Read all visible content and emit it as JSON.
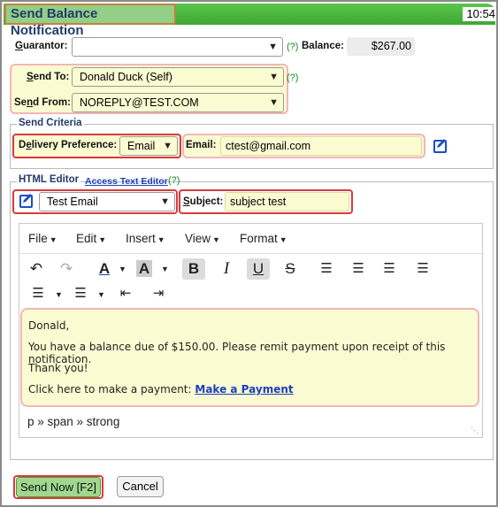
{
  "window": {
    "title": "Send Balance Notification",
    "clock": "10:54"
  },
  "guarantor": {
    "label": "Guarantor:",
    "value": "",
    "help": "(?)",
    "balance_label": "Balance:",
    "balance_value": "$267.00"
  },
  "send_to": {
    "label": "Send To:",
    "value": "Donald Duck (Self)",
    "help": "(?)"
  },
  "send_from": {
    "label": "Send From:",
    "value": "NOREPLY@TEST.COM"
  },
  "criteria": {
    "legend": "Send Criteria",
    "delivery_label": "Delivery Preference:",
    "delivery_value": "Email",
    "email_label": "Email:",
    "email_value": "ctest@gmail.com"
  },
  "html_editor": {
    "legend": "HTML Editor",
    "access_link": "Access Text Editor",
    "help": "(?)",
    "template_value": "Test Email",
    "subject_label": "Subject:",
    "subject_value": "subject test",
    "menus": [
      "File",
      "Edit",
      "Insert",
      "View",
      "Format"
    ],
    "body": {
      "line1": "Donald,",
      "line2": "You have a balance due of $150.00. Please remit payment upon receipt of this notification.",
      "line3": "Thank you!",
      "line4_prefix": "Click here to make a payment:",
      "payment_link": "Make a Payment"
    },
    "status_path": "p » span » strong"
  },
  "buttons": {
    "send_now": "Send Now [F2]",
    "cancel": "Cancel"
  }
}
